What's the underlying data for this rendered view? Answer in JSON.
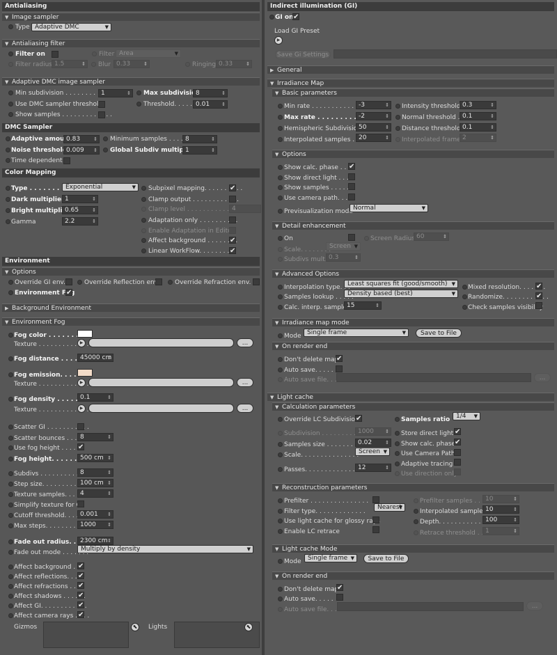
{
  "left": {
    "antialiasing": {
      "title": "Antialiasing",
      "image_sampler": {
        "title": "Image sampler",
        "type_label": "Type",
        "type_value": "Adaptive DMC"
      },
      "aa_filter": {
        "title": "Antialiasing filter",
        "filter_on": "Filter on",
        "filter_label": "Filter",
        "filter_value": "Area",
        "filter_radius_label": "Filter radius",
        "filter_radius": "1.5",
        "blur_label": "Blur",
        "blur": "0.33",
        "ringing_label": "Ringing",
        "ringing": "0.33"
      },
      "adaptive_dmc": {
        "title": "Adaptive DMC image sampler",
        "min_subdiv_label": "Min subdivision . . . . . . . . . .",
        "min_subdiv": "1",
        "max_subdiv_label": "Max subdivision",
        "max_subdiv": "8",
        "use_dmc_label": "Use DMC sampler threshold",
        "threshold_label": "Threshold. . . . . .",
        "threshold": "0.01",
        "show_samples_label": "Show samples . . . . . . . . . . . . ."
      }
    },
    "dmc_sampler": {
      "title": "DMC Sampler",
      "adaptive_amount_label": "Adaptive amount",
      "adaptive_amount": "0.83",
      "min_samples_label": "Minimum samples . . . . . . . .",
      "min_samples": "8",
      "noise_threshold_label": "Noise threshold",
      "noise_threshold": "0.009",
      "global_subdiv_label": "Global Subdiv multiplier",
      "global_subdiv": "1",
      "time_dependent_label": "Time dependent"
    },
    "color_mapping": {
      "title": "Color Mapping",
      "type_label": "Type . . . . . . . . . .",
      "type_value": "Exponential",
      "dark_label": "Dark multiplier",
      "dark": "1",
      "bright_label": "Bright multiplier",
      "bright": "0.65",
      "gamma_label": "Gamma",
      "gamma": "2.2",
      "subpixel_label": "Subpixel mapping. . . . . . . . . .",
      "clamp_output_label": "Clamp output . . . . . . . . . . . .",
      "clamp_level_label": "Clamp level . . . . . . . . . . . . .",
      "clamp_level": "4",
      "adaptation_only_label": "Adaptation only . . . . . . . . . .",
      "enable_adaptation_label": "Enable Adaptation in Editor",
      "affect_bg_label": "Affect background . . . . . . . .",
      "linear_label": "Linear WorkFlow. . . . . . . . ."
    },
    "environment": {
      "title": "Environment",
      "options_title": "Options",
      "override_gi": "Override GI env.",
      "override_reflection": "Override Reflection env.",
      "override_refraction": "Override Refraction env.",
      "environment_fog": "Environment Fog",
      "background_env_title": "Background Environment"
    },
    "env_fog": {
      "title": "Environment Fog",
      "fog_color_label": "Fog color . . . . . . . . .",
      "fog_color": "#ffffff",
      "texture_label": "Texture . . . . . . . . . . . . .",
      "fog_distance_label": "Fog distance . . . . . . . .",
      "fog_distance": "45000 cm",
      "fog_emission_label": "Fog emission. . . . . . .",
      "fog_emission": "#f3dcc8",
      "fog_density_label": "Fog density . . . . . . . . .",
      "fog_density": "0.1",
      "scatter_gi_label": "Scatter GI . . . . . . . . . . .",
      "scatter_bounces_label": "Scatter bounces . . . . . . .",
      "scatter_bounces": "8",
      "use_fog_height_label": "Use fog height . . . . . .",
      "fog_height_label": "Fog height. . . . . . . . . . .",
      "fog_height": "500 cm",
      "subdivs_label": "Subdivs . . . . . . . . . . . . .",
      "subdivs": "8",
      "step_size_label": "Step size. . . . . . . . . . . .",
      "step_size": "100 cm",
      "texture_samples_label": "Texture samples. . . . . . .",
      "texture_samples": "4",
      "simplify_label": "Simplify texture for GI",
      "cutoff_label": "Cutoff threshold. . . . . . .",
      "cutoff": "0.001",
      "max_steps_label": "Max steps. . . . . . . . . . .",
      "max_steps": "1000",
      "fade_radius_label": "Fade out radius. . . . . . .",
      "fade_radius": "2300 cm",
      "fade_mode_label": "Fade out mode . . . . . . .",
      "fade_mode": "Multiply by density",
      "affect_bg_label": "Affect background . . .",
      "affect_refl_label": "Affect reflections. . . . .",
      "affect_refr_label": "Affect refractions . . . .",
      "affect_shadows_label": "Affect shadows . . . . . .",
      "affect_gi_label": "Affect GI. . . . . . . . . . . .",
      "affect_cam_label": "Affect camera rays . . . .",
      "gizmos_label": "Gizmos",
      "lights_label": "Lights",
      "browse": "..."
    }
  },
  "right": {
    "gi_title": "Indirect illumination (GI)",
    "gi_on": "GI on",
    "load_preset": "Load GI Preset",
    "save_settings": "Save Gi Settings",
    "general_title": "General",
    "irradiance": {
      "title": "Irradiance Map",
      "basic_title": "Basic parameters",
      "min_rate_label": "Min rate . . . . . . . . . . . . . .",
      "min_rate": "-3",
      "max_rate_label": "Max rate . . . . . . . . . . . . .",
      "max_rate": "-2",
      "hemi_label": "Hemispheric Subdivision",
      "hemi": "50",
      "interp_label": "Interpolated samples . . .",
      "interp": "20",
      "intensity_label": "Intensity threshold",
      "intensity": "0.3",
      "normal_label": "Normal threshold . .",
      "normal": "0.1",
      "distance_label": "Distance threshold",
      "distance": "0.1",
      "interp_frames_label": "Interpolated frames",
      "interp_frames": "2",
      "options_title": "Options",
      "show_calc_label": "Show calc. phase . . . .",
      "show_direct_label": "Show direct light . . . .",
      "show_samples_label": "Show samples . . . . . .",
      "use_camera_label": "Use camera path. . . . .",
      "previs_label": "Previsualization mode",
      "previs": "Normal",
      "detail_title": "Detail enhancement",
      "on_label": "On",
      "screen_radius_label": "Screen Radius",
      "screen_radius": "60",
      "scale_label": "Scale. . . . . . . .",
      "scale": "Screen",
      "subdivs_mult_label": "Subdivs mult.",
      "subdivs_mult": "0.3",
      "advanced_title": "Advanced Options",
      "interp_type_label": "Interpolation type. . .",
      "interp_type": "Least squares fit (good/smooth)",
      "lookup_label": "Samples lookup . . . . .",
      "lookup": "Density based (best)",
      "calc_interp_label": "Calc. interp. samples",
      "calc_interp": "15",
      "mixed_label": "Mixed resolution. . . . . . .",
      "randomize_label": "Randomize. . . . . . . . . . . .",
      "check_vis_label": "Check samples visibility",
      "mode_title": "Irradiance map mode",
      "mode_label": "Mode",
      "mode": "Single frame",
      "save_file": "Save to File",
      "render_end_title": "On render end",
      "dont_delete_label": "Don't delete map",
      "auto_save_label": "Auto save. . . . .",
      "auto_save_file_label": "Auto save file. . . .",
      "browse": "..."
    },
    "light_cache": {
      "title": "Light cache",
      "calc_title": "Calculation parameters",
      "override_label": "Override LC Subdivision",
      "samples_ratio_label": "Samples ratio",
      "samples_ratio": "1/4",
      "subdivision_label": "Subdivision . . . . . . . . . . .",
      "subdivision": "1000",
      "samples_size_label": "Samples size . . . . . . . . .",
      "samples_size": "0.02",
      "scale_label": "Scale. . . . . . . . . . . . . . .",
      "scale": "Screen",
      "passes_label": "Passes. . . . . . . . . . . . . .",
      "passes": "12",
      "store_direct_label": "Store direct light",
      "show_calc_label": "Show calc. phase",
      "use_camera_label": "Use Camera Path",
      "adaptive_label": "Adaptive tracing",
      "use_dir_label": "Use direction only",
      "recon_title": "Reconstruction parameters",
      "prefilter_label": "Prefilter . . . . . . . . . . . . . . .",
      "filter_type_label": "Filter type. . . . . . . . . . . . .",
      "filter_type": "Nearest",
      "glossy_label": "Use light cache for glossy rays",
      "retrace_label": "Enable LC retrace",
      "prefilter_samples_label": "Prefilter samples . . . .",
      "prefilter_samples": "10",
      "interp_label": "Interpolated samples",
      "interp": "10",
      "depth_label": "Depth. . . . . . . . . . . . .",
      "depth": "100",
      "retrace_thr_label": "Retrace threshold . . . .",
      "retrace_thr": "1",
      "mode_title": "Light cache Mode",
      "mode_label": "Mode",
      "mode": "Single frame",
      "save_file": "Save to File",
      "render_end_title": "On render end",
      "dont_delete_label": "Don't delete map",
      "auto_save_label": "Auto save. . . . .",
      "auto_save_file_label": "Auto save file. . . .",
      "browse": "..."
    }
  },
  "icons": {
    "check": "✔",
    "expanded": "▼",
    "collapsed": "▶",
    "spin": "⇕",
    "drop": "▼",
    "play": "▶",
    "pick": "⬉"
  },
  "colors": {
    "panel_bg": "#575757",
    "header_bg": "#3c3c3c",
    "field_bg": "#3a3a3a",
    "dropdown_bg": "#d0d0d0"
  }
}
